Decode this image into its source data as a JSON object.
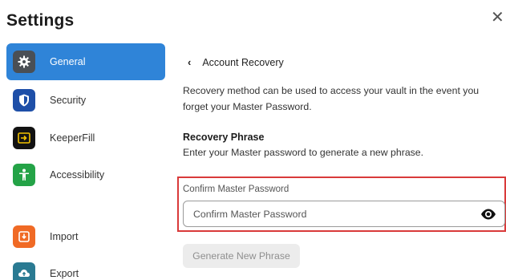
{
  "header": {
    "title": "Settings",
    "close_icon": "close-icon",
    "close_glyph": "✕"
  },
  "sidebar": {
    "items": [
      {
        "label": "General",
        "icon": "gear-icon",
        "icon_color": "#4a4f55",
        "active": true
      },
      {
        "label": "Security",
        "icon": "shield-icon",
        "icon_color": "#1e4fa8",
        "active": false
      },
      {
        "label": "KeeperFill",
        "icon": "keeperfill-icon",
        "icon_color": "#121212",
        "active": false
      },
      {
        "label": "Accessibility",
        "icon": "accessibility-icon",
        "icon_color": "#24a347",
        "active": false
      },
      {
        "label": "Import",
        "icon": "import-icon",
        "icon_color": "#f06a25",
        "active": false
      },
      {
        "label": "Export",
        "icon": "export-icon",
        "icon_color": "#2a7a92",
        "active": false
      }
    ],
    "active_color": "#2f84d8"
  },
  "main": {
    "back_label": "Account Recovery",
    "description": "Recovery method can be used to access your vault in the event you forget your Master Password.",
    "section_title": "Recovery Phrase",
    "section_description": "Enter your Master password to generate a new phrase.",
    "field": {
      "label": "Confirm Master Password",
      "placeholder": "Confirm Master Password",
      "value": "",
      "icon": "eye-icon"
    },
    "generate_button": "Generate New Phrase",
    "highlight_color": "#d93a3a"
  }
}
